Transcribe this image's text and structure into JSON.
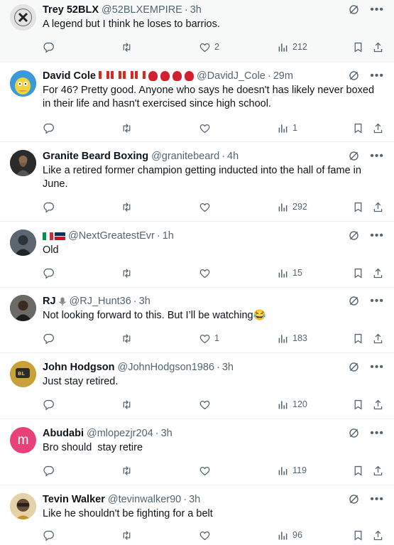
{
  "tweets": [
    {
      "name": "Trey 52BLX",
      "handle": "@52BLXEMPIRE",
      "time": "3h",
      "text": "A legend but I think he loses to barrios.",
      "likes": "2",
      "views": "212",
      "avatar_color": "#d9d9d9"
    },
    {
      "name": "David Cole",
      "handle": "@DavidJ_Cole",
      "time": "29m",
      "text": "For 46? Pretty good. Anyone who says he doesn't has likely never boxed in their life and hasn't exercised since high school.",
      "likes": "",
      "views": "1",
      "avatar_color": "#3a9ad9"
    },
    {
      "name": "Granite Beard Boxing",
      "handle": "@granitebeard",
      "time": "4h",
      "text": "Like a retired former champion getting inducted into the hall of fame in June.",
      "likes": "",
      "views": "292",
      "avatar_color": "#2b2b2b"
    },
    {
      "name": "",
      "handle": "@NextGreatestEvr",
      "time": "1h",
      "text": "Old",
      "likes": "",
      "views": "15",
      "avatar_color": "#3d4650"
    },
    {
      "name": "RJ",
      "handle": "@RJ_Hunt36",
      "time": "3h",
      "text": "Not looking forward to this. But I’ll be watching😂",
      "likes": "1",
      "views": "183",
      "avatar_color": "#3b3a36"
    },
    {
      "name": "John Hodgson",
      "handle": "@JohnHodgson1986",
      "time": "3h",
      "text": "Just stay retired.",
      "likes": "",
      "views": "120",
      "avatar_color": "#c9a13a"
    },
    {
      "name": "Abudabi",
      "handle": "@mlopezjr204",
      "time": "3h",
      "text": "Bro should  stay retire",
      "likes": "",
      "views": "119",
      "avatar_color": "#e8417a",
      "avatar_letter": "m"
    },
    {
      "name": "Tevin Walker",
      "handle": "@tevinwalker90",
      "time": "3h",
      "text": "Like he shouldn't be fighting for a belt",
      "likes": "",
      "views": "96",
      "avatar_color": "#d9b070"
    }
  ],
  "icons": {
    "reply": "reply-icon",
    "retweet": "retweet-icon",
    "like": "heart-icon",
    "views": "views-icon",
    "bookmark": "bookmark-icon",
    "share": "share-icon",
    "grok": "grok-icon",
    "more": "more-icon"
  },
  "more_glyph": "•••"
}
